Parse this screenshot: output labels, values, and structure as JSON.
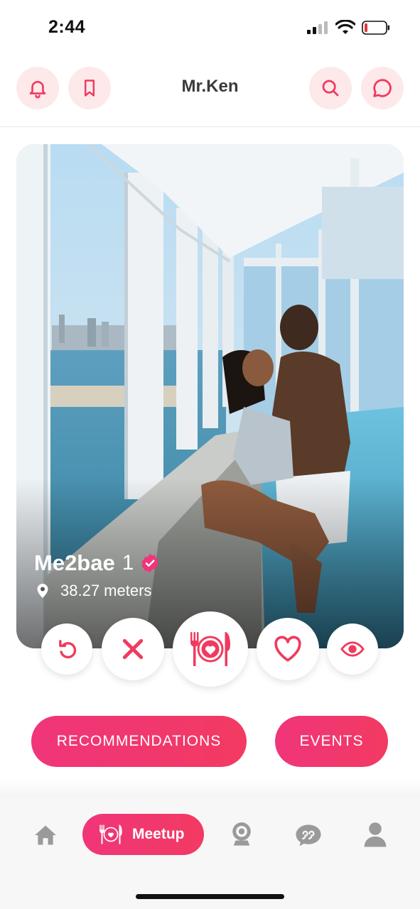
{
  "status_bar": {
    "time": "2:44"
  },
  "header": {
    "title": "Mr.Ken"
  },
  "profile": {
    "name": "Me2bae",
    "age": "1",
    "distance": "38.27 meters"
  },
  "actions": {
    "rewind": "rewind-icon",
    "dislike": "close-icon",
    "meetup": "dinner-plate-icon",
    "like": "heart-icon",
    "view": "eye-icon"
  },
  "buttons": {
    "recommendations": "RECOMMENDATIONS",
    "events": "EVENTS"
  },
  "bottom_nav": {
    "active_label": "Meetup"
  },
  "colors": {
    "accent": "#f0357a",
    "accent_light": "#fde8ea",
    "icon_gray": "#9a9a9a"
  }
}
